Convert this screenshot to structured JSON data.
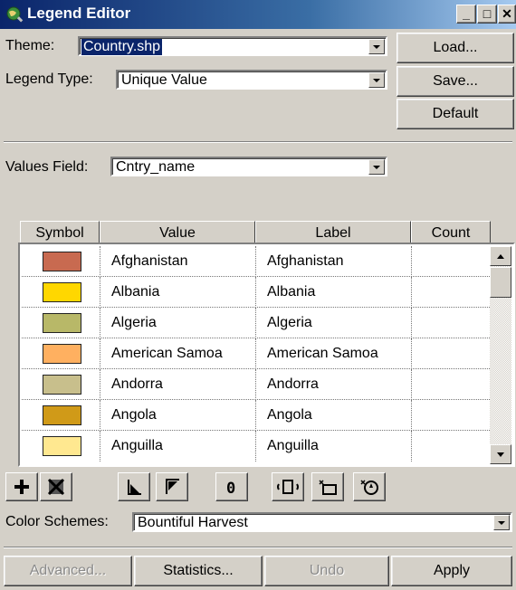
{
  "window": {
    "title": "Legend Editor"
  },
  "theme": {
    "label": "Theme:",
    "value": "Country.shp"
  },
  "legend_type": {
    "label": "Legend Type:",
    "value": "Unique Value"
  },
  "buttons": {
    "load": "Load...",
    "save": "Save...",
    "default": "Default"
  },
  "values_field": {
    "label": "Values Field:",
    "value": "Cntry_name"
  },
  "table": {
    "headers": [
      "Symbol",
      "Value",
      "Label",
      "Count"
    ],
    "rows": [
      {
        "color": "#c86a50",
        "value": "Afghanistan",
        "label": "Afghanistan",
        "count": ""
      },
      {
        "color": "#ffd700",
        "value": "Albania",
        "label": "Albania",
        "count": ""
      },
      {
        "color": "#b8b868",
        "value": "Algeria",
        "label": "Algeria",
        "count": ""
      },
      {
        "color": "#ffb060",
        "value": "American Samoa",
        "label": "American Samoa",
        "count": ""
      },
      {
        "color": "#c8bf8c",
        "value": "Andorra",
        "label": "Andorra",
        "count": ""
      },
      {
        "color": "#d09a18",
        "value": "Angola",
        "label": "Angola",
        "count": ""
      },
      {
        "color": "#ffe890",
        "value": "Anguilla",
        "label": "Anguilla",
        "count": ""
      }
    ]
  },
  "toolbar_icons": [
    "add-icon",
    "delete-icon",
    "sort-ascending-icon",
    "sort-descending-icon",
    "zero-icon",
    "import-icon",
    "pick-icon",
    "spin-icon"
  ],
  "color_schemes": {
    "label": "Color Schemes:",
    "value": "Bountiful Harvest"
  },
  "bottom_buttons": {
    "advanced": "Advanced...",
    "statistics": "Statistics...",
    "undo": "Undo",
    "apply": "Apply"
  },
  "colors": {
    "titlebar": "#0a246a",
    "face": "#d4d0c8"
  }
}
